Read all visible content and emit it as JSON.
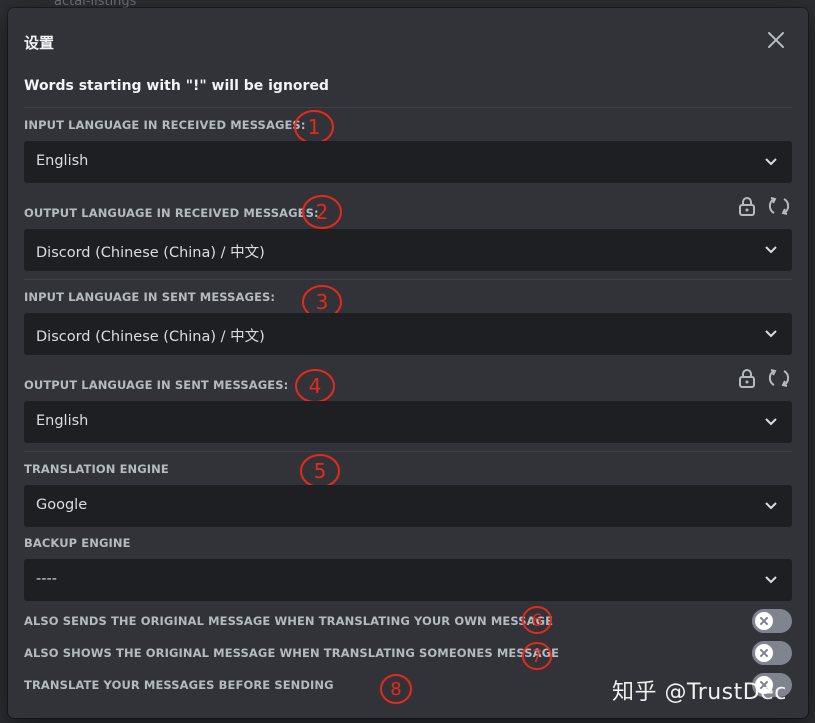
{
  "background": {
    "bg_text_1": "actal-listings"
  },
  "modal": {
    "title": "设置",
    "notice": "Words starting with \"!\" will be ignored"
  },
  "settings": {
    "input_received": {
      "label": "INPUT LANGUAGE IN RECEIVED MESSAGES:",
      "value": "English",
      "annotation": "1"
    },
    "output_received": {
      "label": "OUTPUT LANGUAGE IN RECEIVED MESSAGES:",
      "value": "Discord (Chinese (China) / 中文)",
      "annotation": "2"
    },
    "input_sent": {
      "label": "INPUT LANGUAGE IN SENT MESSAGES:",
      "value": "Discord (Chinese (China) / 中文)",
      "annotation": "3"
    },
    "output_sent": {
      "label": "OUTPUT LANGUAGE IN SENT MESSAGES:",
      "value": "English",
      "annotation": "4"
    },
    "engine": {
      "label": "TRANSLATION ENGINE",
      "value": "Google",
      "annotation": "5"
    },
    "backup_engine": {
      "label": "BACKUP ENGINE",
      "value": "----"
    }
  },
  "toggles": {
    "send_original": {
      "label": "ALSO SENDS THE ORIGINAL MESSAGE WHEN TRANSLATING YOUR OWN MESSAGE",
      "annotation": "6",
      "on": false
    },
    "show_original": {
      "label": "ALSO SHOWS THE ORIGINAL MESSAGE WHEN TRANSLATING SOMEONES MESSAGE",
      "annotation": "7",
      "on": false
    },
    "translate_before_send": {
      "label": "TRANSLATE YOUR MESSAGES BEFORE SENDING",
      "annotation": "8",
      "on": false
    }
  },
  "icons": {
    "close": "close-icon",
    "chevron": "chevron-down-icon",
    "lock": "lock-icon",
    "swap": "swap-icon",
    "toggle_off": "x-icon"
  },
  "watermark": "知乎 @TrustDec",
  "colors": {
    "modal_bg": "#313338",
    "select_bg": "#1e1f22",
    "label": "#b5bac1",
    "annotation": "#e52a1c",
    "toggle_off": "#80848e"
  }
}
